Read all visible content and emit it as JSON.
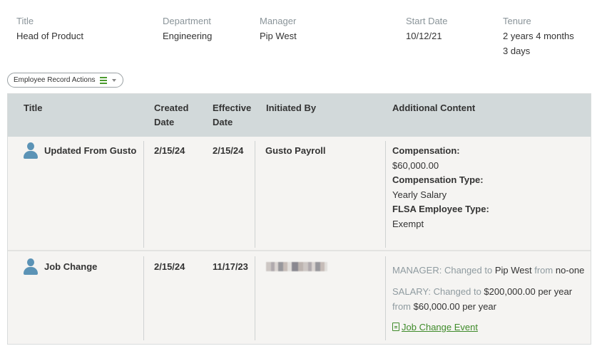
{
  "summary": {
    "title": {
      "label": "Title",
      "value": "Head of Product"
    },
    "department": {
      "label": "Department",
      "value": "Engineering"
    },
    "manager": {
      "label": "Manager",
      "value": "Pip West"
    },
    "start_date": {
      "label": "Start Date",
      "value": "10/12/21"
    },
    "tenure": {
      "label": "Tenure",
      "value_line1": "2 years 4 months",
      "value_line2": "3 days"
    }
  },
  "actions_button": {
    "label": "Employee Record Actions",
    "icon": "list-icon",
    "accent": "#4a9a2e"
  },
  "table": {
    "headers": {
      "title": "Title",
      "created_l1": "Created",
      "created_l2": "Date",
      "effective_l1": "Effective",
      "effective_l2": "Date",
      "initiated_by": "Initiated By",
      "additional": "Additional Content"
    },
    "rows": [
      {
        "icon": "person-icon",
        "title": "Updated From Gusto",
        "created": "2/15/24",
        "effective": "2/15/24",
        "initiated_by": "Gusto Payroll",
        "content": {
          "comp_label": "Compensation:",
          "comp_value": "$60,000.00",
          "comp_type_label": "Compensation Type:",
          "comp_type_value": "Yearly Salary",
          "flsa_label": "FLSA Employee Type:",
          "flsa_value": "Exempt"
        }
      },
      {
        "icon": "person-icon",
        "title": "Job Change",
        "created": "2/15/24",
        "effective": "11/17/23",
        "initiated_by_redacted": true,
        "content": {
          "manager_prefix": "MANAGER: Changed to",
          "manager_to": "Pip West",
          "manager_from_word": "from",
          "manager_from": "no-one",
          "salary_prefix": "SALARY: Changed to",
          "salary_to": "$200,000.00 per year",
          "salary_from_word": "from",
          "salary_from": "$60,000.00 per year",
          "link_label": "Job Change Event",
          "link_icon": "document-icon"
        }
      }
    ]
  }
}
